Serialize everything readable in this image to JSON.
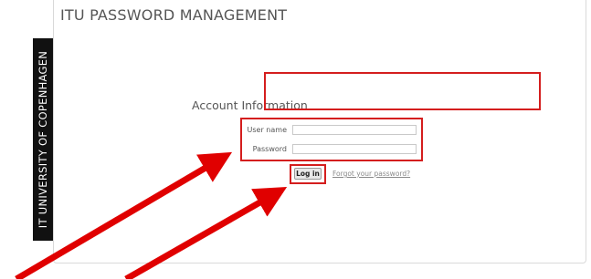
{
  "app": {
    "title": "ITU PASSWORD MANAGEMENT",
    "brand": "IT UNIVERSITY OF COPENHAGEN"
  },
  "form": {
    "section_title": "Account Information",
    "username_label": "User name",
    "username_value": "",
    "password_label": "Password",
    "password_value": "",
    "login_label": "Log in",
    "forgot_label": "Forgot your password?"
  },
  "annotations": {
    "highlight_color": "#d41e1e",
    "arrow_color": "#e00000"
  }
}
